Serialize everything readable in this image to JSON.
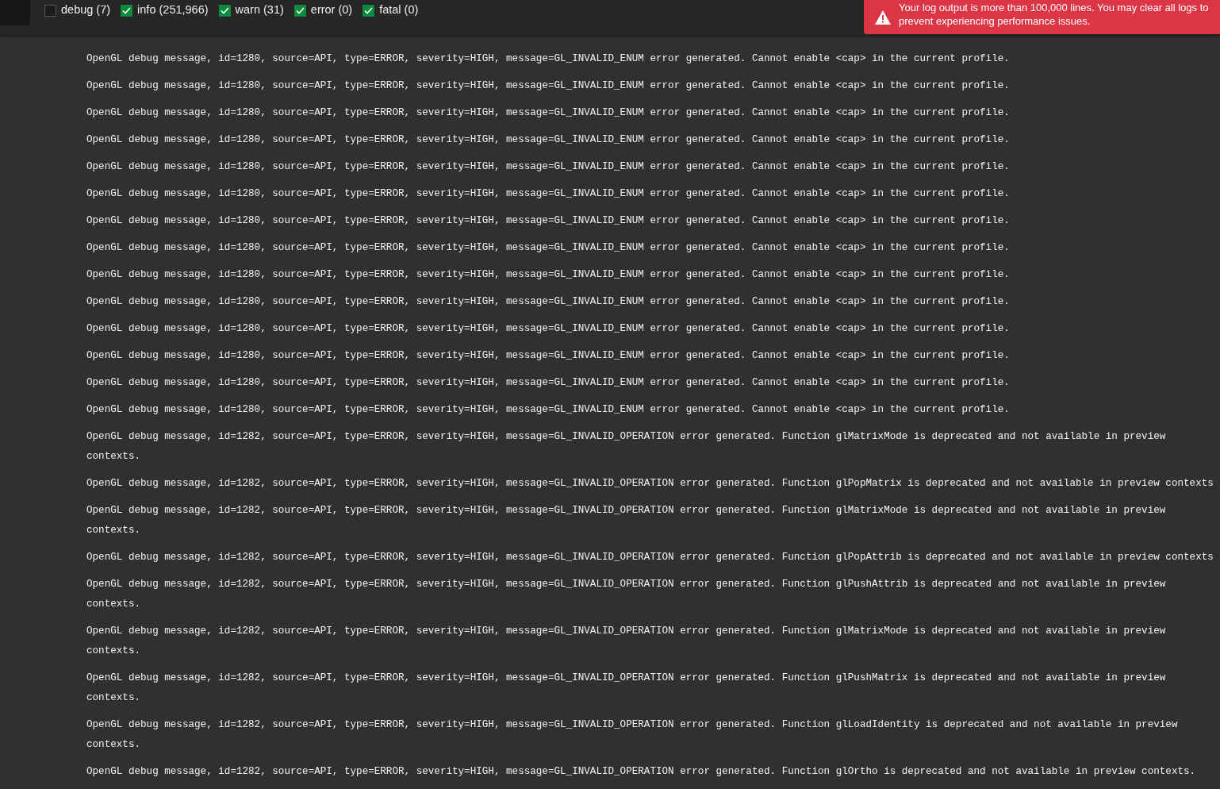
{
  "filters": [
    {
      "label": "debug (7)",
      "checked": false
    },
    {
      "label": "info (251,966)",
      "checked": true
    },
    {
      "label": "warn (31)",
      "checked": true
    },
    {
      "label": "error (0)",
      "checked": true
    },
    {
      "label": "fatal (0)",
      "checked": true
    }
  ],
  "alert": {
    "text": "Your log output is more than 100,000 lines. You may clear all logs to prevent experiencing performance issues."
  },
  "log_lines": [
    {
      "lines": [
        "OpenGL debug message, id=1280, source=API, type=ERROR, severity=HIGH, message=GL_INVALID_ENUM error generated. Cannot enable <cap> in the current profile."
      ]
    },
    {
      "lines": [
        "OpenGL debug message, id=1280, source=API, type=ERROR, severity=HIGH, message=GL_INVALID_ENUM error generated. Cannot enable <cap> in the current profile."
      ]
    },
    {
      "lines": [
        "OpenGL debug message, id=1280, source=API, type=ERROR, severity=HIGH, message=GL_INVALID_ENUM error generated. Cannot enable <cap> in the current profile."
      ]
    },
    {
      "lines": [
        "OpenGL debug message, id=1280, source=API, type=ERROR, severity=HIGH, message=GL_INVALID_ENUM error generated. Cannot enable <cap> in the current profile."
      ]
    },
    {
      "lines": [
        "OpenGL debug message, id=1280, source=API, type=ERROR, severity=HIGH, message=GL_INVALID_ENUM error generated. Cannot enable <cap> in the current profile."
      ]
    },
    {
      "lines": [
        "OpenGL debug message, id=1280, source=API, type=ERROR, severity=HIGH, message=GL_INVALID_ENUM error generated. Cannot enable <cap> in the current profile."
      ]
    },
    {
      "lines": [
        "OpenGL debug message, id=1280, source=API, type=ERROR, severity=HIGH, message=GL_INVALID_ENUM error generated. Cannot enable <cap> in the current profile."
      ]
    },
    {
      "lines": [
        "OpenGL debug message, id=1280, source=API, type=ERROR, severity=HIGH, message=GL_INVALID_ENUM error generated. Cannot enable <cap> in the current profile."
      ]
    },
    {
      "lines": [
        "OpenGL debug message, id=1280, source=API, type=ERROR, severity=HIGH, message=GL_INVALID_ENUM error generated. Cannot enable <cap> in the current profile."
      ]
    },
    {
      "lines": [
        "OpenGL debug message, id=1280, source=API, type=ERROR, severity=HIGH, message=GL_INVALID_ENUM error generated. Cannot enable <cap> in the current profile."
      ]
    },
    {
      "lines": [
        "OpenGL debug message, id=1280, source=API, type=ERROR, severity=HIGH, message=GL_INVALID_ENUM error generated. Cannot enable <cap> in the current profile."
      ]
    },
    {
      "lines": [
        "OpenGL debug message, id=1280, source=API, type=ERROR, severity=HIGH, message=GL_INVALID_ENUM error generated. Cannot enable <cap> in the current profile."
      ]
    },
    {
      "lines": [
        "OpenGL debug message, id=1280, source=API, type=ERROR, severity=HIGH, message=GL_INVALID_ENUM error generated. Cannot enable <cap> in the current profile."
      ]
    },
    {
      "lines": [
        "OpenGL debug message, id=1280, source=API, type=ERROR, severity=HIGH, message=GL_INVALID_ENUM error generated. Cannot enable <cap> in the current profile."
      ]
    },
    {
      "lines": [
        "OpenGL debug message, id=1282, source=API, type=ERROR, severity=HIGH, message=GL_INVALID_OPERATION error generated. Function glMatrixMode is deprecated and not available in preview",
        "contexts."
      ]
    },
    {
      "lines": [
        "OpenGL debug message, id=1282, source=API, type=ERROR, severity=HIGH, message=GL_INVALID_OPERATION error generated. Function glPopMatrix is deprecated and not available in preview contexts"
      ]
    },
    {
      "lines": [
        "OpenGL debug message, id=1282, source=API, type=ERROR, severity=HIGH, message=GL_INVALID_OPERATION error generated. Function glMatrixMode is deprecated and not available in preview",
        "contexts."
      ]
    },
    {
      "lines": [
        "OpenGL debug message, id=1282, source=API, type=ERROR, severity=HIGH, message=GL_INVALID_OPERATION error generated. Function glPopAttrib is deprecated and not available in preview contexts"
      ]
    },
    {
      "lines": [
        "OpenGL debug message, id=1282, source=API, type=ERROR, severity=HIGH, message=GL_INVALID_OPERATION error generated. Function glPushAttrib is deprecated and not available in preview",
        "contexts."
      ]
    },
    {
      "lines": [
        "OpenGL debug message, id=1282, source=API, type=ERROR, severity=HIGH, message=GL_INVALID_OPERATION error generated. Function glMatrixMode is deprecated and not available in preview",
        "contexts."
      ]
    },
    {
      "lines": [
        "OpenGL debug message, id=1282, source=API, type=ERROR, severity=HIGH, message=GL_INVALID_OPERATION error generated. Function glPushMatrix is deprecated and not available in preview",
        "contexts."
      ]
    },
    {
      "lines": [
        "OpenGL debug message, id=1282, source=API, type=ERROR, severity=HIGH, message=GL_INVALID_OPERATION error generated. Function glLoadIdentity is deprecated and not available in preview",
        "contexts."
      ]
    },
    {
      "lines": [
        "OpenGL debug message, id=1282, source=API, type=ERROR, severity=HIGH, message=GL_INVALID_OPERATION error generated. Function glOrtho is deprecated and not available in preview contexts."
      ]
    }
  ]
}
